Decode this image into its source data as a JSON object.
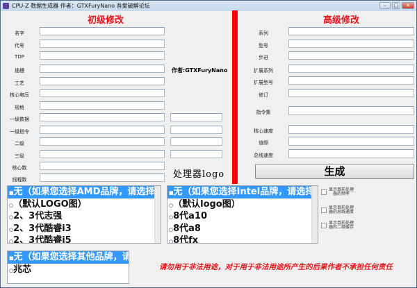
{
  "window": {
    "title": "CPU-Z 数据生成器 作者：GTXFuryNano 吾爱破解论坛",
    "minimize": "–",
    "maximize": "□",
    "close": "✕"
  },
  "basic": {
    "heading": "初级修改",
    "labels": [
      "名字",
      "代号",
      "TDP",
      "插槽",
      "工艺",
      "核心电压",
      "规格",
      "一级数据",
      "一级指令",
      "二级",
      "三级",
      "核心数",
      "线程数"
    ],
    "author": "作者:GTXFuryNano",
    "logo_label": "处理器logo"
  },
  "advanced": {
    "heading": "高级修改",
    "labels": [
      "系列",
      "型号",
      "步进",
      "扩展系列",
      "扩展型号",
      "修订",
      "指令集",
      "核心速度",
      "倍频",
      "总线速度"
    ],
    "generate": "生成"
  },
  "amd_list": [
    "无（如果您选择AMD品牌，请选择此项）",
    "（默认LOGO图）",
    "2、3代志强",
    "2、3代酷睿i3",
    "2、3代酷睿i5"
  ],
  "intel_list": [
    "无（如果您选择Intel品牌，请选择此项）",
    "（默认logo图）",
    "8代a10",
    "8代a8",
    "8代fx"
  ],
  "other_list": [
    "无（如果您选择其他品牌，请选择此项）",
    "兆芯"
  ],
  "checkboxes": [
    "显示目前处理器的频率",
    "显示目前处理器的总线速度",
    "显示目前处理器的二级缓存"
  ],
  "warning": "请勿用于非法用途，对于用于非法用途所产生的后果作者不承担任何责任",
  "colors": {
    "accent": "#e2141b",
    "selection": "#3399ff"
  }
}
